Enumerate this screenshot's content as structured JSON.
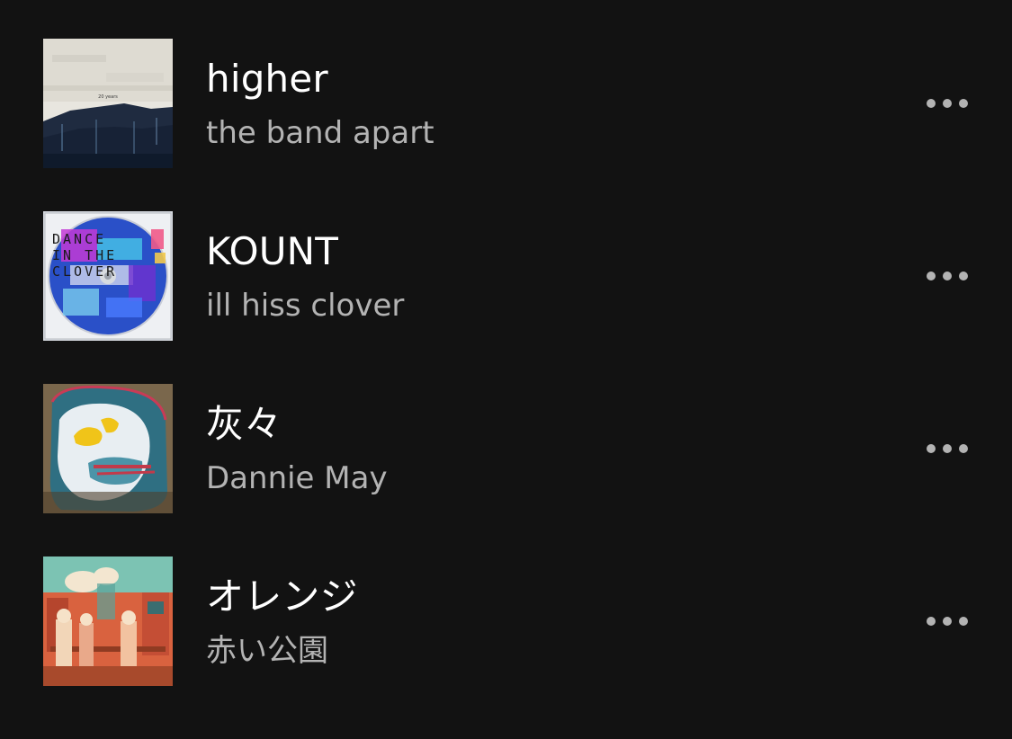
{
  "tracks": [
    {
      "title": "higher",
      "artist": "the band apart",
      "art": "album-art-higher",
      "art_text": "20 years"
    },
    {
      "title": "KOUNT",
      "artist": "ill hiss clover",
      "art": "album-art-kount",
      "art_text": [
        "DANCE",
        "IN THE",
        "CLOVER"
      ]
    },
    {
      "title": "灰々",
      "artist": "Dannie May",
      "art": "album-art-haihai"
    },
    {
      "title": "オレンジ",
      "artist": "赤い公園",
      "art": "album-art-orange"
    }
  ],
  "more_icon": "more-options-icon"
}
